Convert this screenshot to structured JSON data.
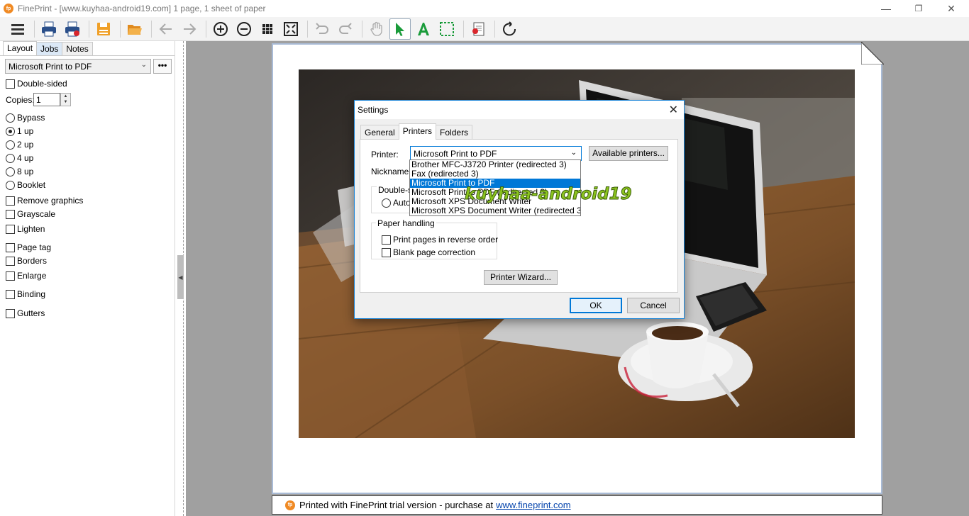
{
  "window": {
    "title": "FinePrint - [www.kuyhaa-android19.com] 1 page, 1 sheet of paper",
    "app_icon_text": "fp",
    "minimize": "—",
    "restore": "❐",
    "close": "✕"
  },
  "toolbar": {
    "items": [
      "menu-icon",
      "print-icon",
      "print-delete-icon",
      "save-icon",
      "open-folder-icon",
      "back-arrow-icon",
      "forward-arrow-icon",
      "zoom-in-icon",
      "zoom-out-icon",
      "grid-icon",
      "fit-page-icon",
      "undo-icon",
      "redo-icon",
      "hand-icon",
      "select-arrow-icon",
      "text-icon",
      "crop-icon",
      "delete-page-icon",
      "refresh-icon"
    ],
    "accent": "#1a9b3a"
  },
  "sidebar": {
    "tabs": [
      "Layout",
      "Jobs",
      "Notes"
    ],
    "printer": "Microsoft Print to PDF",
    "more_label": "•••",
    "double_sided": "Double-sided",
    "copies_label": "Copies:",
    "copies_value": "1",
    "layouts": [
      "Bypass",
      "1 up",
      "2 up",
      "4 up",
      "8 up",
      "Booklet"
    ],
    "selected_layout": "1 up",
    "options": [
      "Remove graphics",
      "Grayscale",
      "Lighten",
      "Page tag",
      "Borders",
      "Enlarge",
      "Binding",
      "Gutters"
    ]
  },
  "dialog": {
    "title": "Settings",
    "close": "✕",
    "tabs": [
      "General",
      "Printers",
      "Folders"
    ],
    "active_tab": "Printers",
    "printer_label": "Printer:",
    "nickname_label": "Nickname:",
    "printer_value": "Microsoft Print to PDF",
    "available_button": "Available printers...",
    "duplex_legend": "Double-sid",
    "duplex_auto": "Autor",
    "paper_legend": "Paper handling",
    "reverse_order": "Print pages in reverse order",
    "blank_correction": "Blank page correction",
    "wizard_button": "Printer Wizard...",
    "ok": "OK",
    "cancel": "Cancel",
    "dropdown_options": [
      "Brother MFC-J3720 Printer (redirected 3)",
      "Fax (redirected 3)",
      "Microsoft Print to PDF",
      "Microsoft Print to PDF (redirected 3)",
      "Microsoft XPS Document Writer",
      "Microsoft XPS Document Writer (redirected 3)"
    ],
    "dropdown_selected": "Microsoft Print to PDF"
  },
  "watermark": "kuyhaa-android19",
  "footer": {
    "icon_text": "fp",
    "text": "Printed with FinePrint trial version - purchase at",
    "link": "www.fineprint.com"
  }
}
